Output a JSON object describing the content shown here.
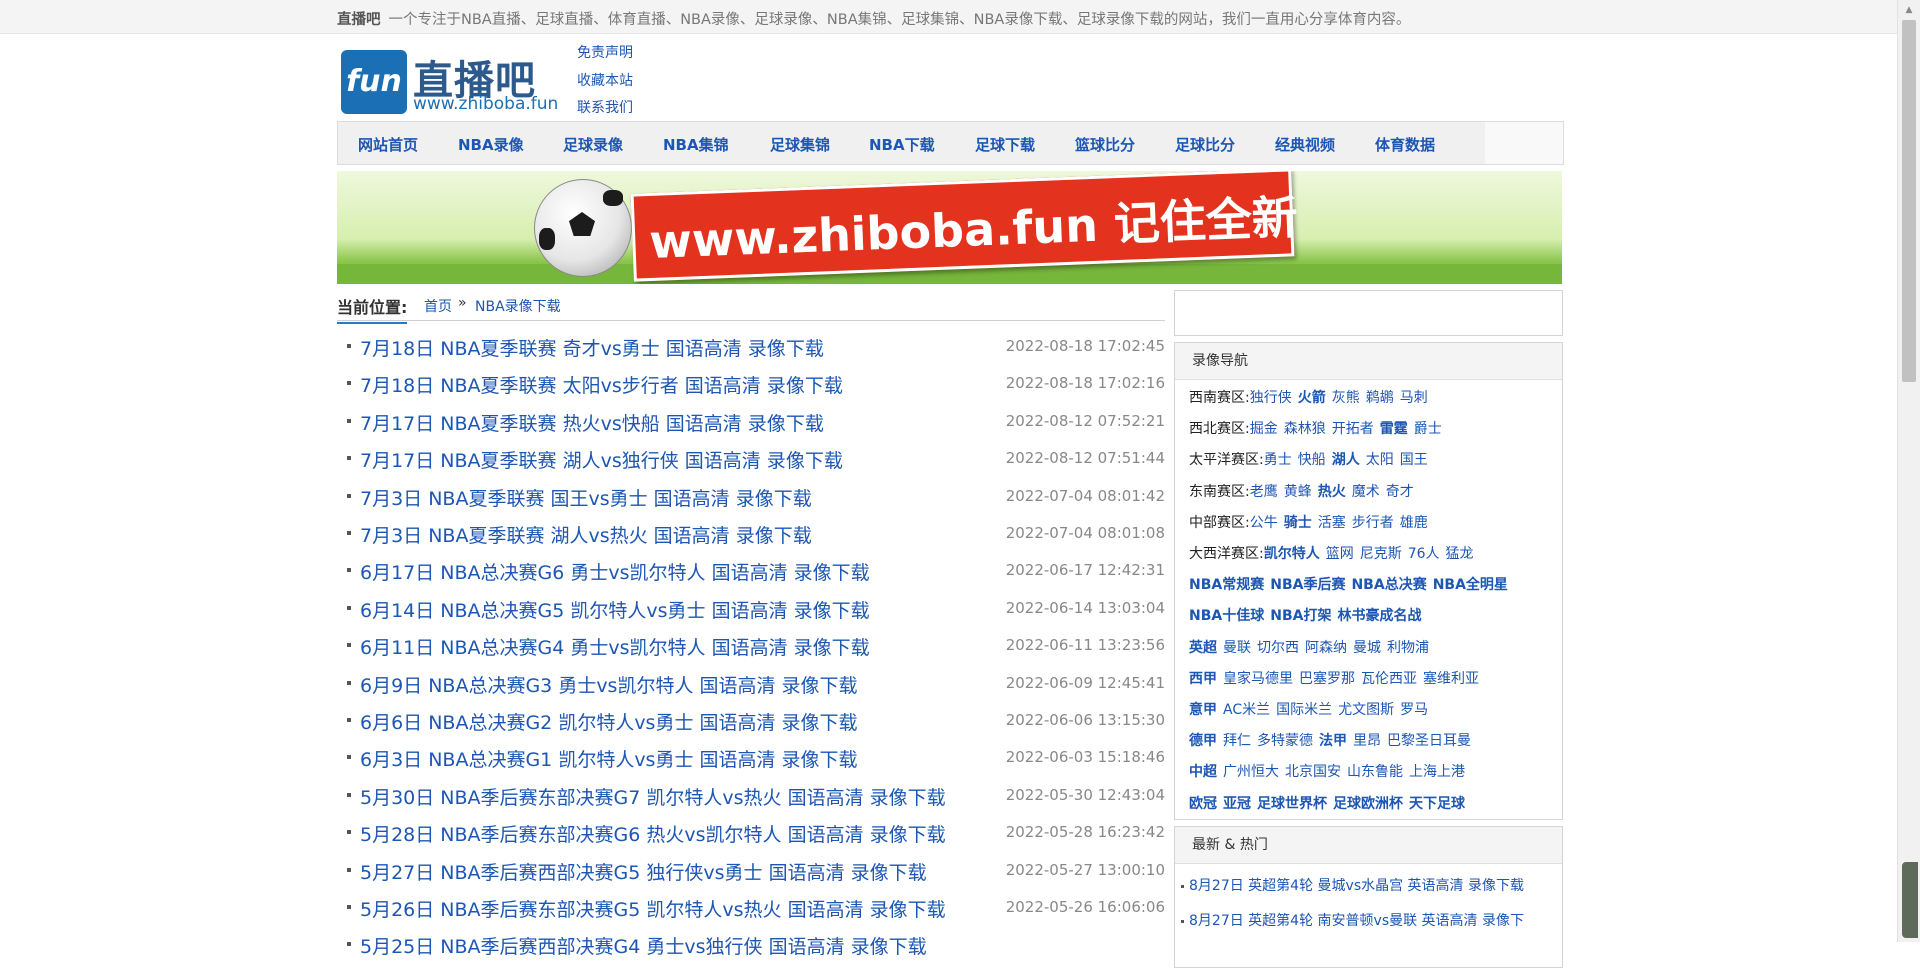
{
  "topbar": {
    "site_name": "直播吧",
    "tagline": "一个专注于NBA直播、足球直播、体育直播、NBA录像、足球录像、NBA集锦、足球集锦、NBA录像下载、足球录像下载的网站，我们一直用心分享体育内容。"
  },
  "logo": {
    "badge": "fun",
    "name": "直播吧",
    "url": "www.zhiboba.fun"
  },
  "toplinks": [
    "免责声明",
    "收藏本站",
    "联系我们"
  ],
  "nav": [
    "网站首页",
    "NBA录像",
    "足球录像",
    "NBA集锦",
    "足球集锦",
    "NBA下载",
    "足球下载",
    "篮球比分",
    "足球比分",
    "经典视频",
    "体育数据"
  ],
  "banner": {
    "text": "www.zhiboba.fun 记住全新"
  },
  "breadcrumb": {
    "label": "当前位置:",
    "home": "首页",
    "separator": "»",
    "current": "NBA录像下载"
  },
  "articles": [
    {
      "title": "7月18日 NBA夏季联赛 奇才vs勇士 国语高清 录像下载",
      "date": "2022-08-18 17:02:45"
    },
    {
      "title": "7月18日 NBA夏季联赛 太阳vs步行者 国语高清 录像下载",
      "date": "2022-08-18 17:02:16"
    },
    {
      "title": "7月17日 NBA夏季联赛 热火vs快船 国语高清 录像下载",
      "date": "2022-08-12 07:52:21"
    },
    {
      "title": "7月17日 NBA夏季联赛 湖人vs独行侠 国语高清 录像下载",
      "date": "2022-08-12 07:51:44"
    },
    {
      "title": "7月3日 NBA夏季联赛 国王vs勇士 国语高清 录像下载",
      "date": "2022-07-04 08:01:42"
    },
    {
      "title": "7月3日 NBA夏季联赛 湖人vs热火 国语高清 录像下载",
      "date": "2022-07-04 08:01:08"
    },
    {
      "title": "6月17日 NBA总决赛G6 勇士vs凯尔特人 国语高清 录像下载",
      "date": "2022-06-17 12:42:31"
    },
    {
      "title": "6月14日 NBA总决赛G5 凯尔特人vs勇士 国语高清 录像下载",
      "date": "2022-06-14 13:03:04"
    },
    {
      "title": "6月11日 NBA总决赛G4 勇士vs凯尔特人 国语高清 录像下载",
      "date": "2022-06-11 13:23:56"
    },
    {
      "title": "6月9日 NBA总决赛G3 勇士vs凯尔特人 国语高清 录像下载",
      "date": "2022-06-09 12:45:41"
    },
    {
      "title": "6月6日 NBA总决赛G2 凯尔特人vs勇士 国语高清 录像下载",
      "date": "2022-06-06 13:15:30"
    },
    {
      "title": "6月3日 NBA总决赛G1 凯尔特人vs勇士 国语高清 录像下载",
      "date": "2022-06-03 15:18:46"
    },
    {
      "title": "5月30日 NBA季后赛东部决赛G7 凯尔特人vs热火 国语高清 录像下载",
      "date": "2022-05-30 12:43:04"
    },
    {
      "title": "5月28日 NBA季后赛东部决赛G6 热火vs凯尔特人 国语高清 录像下载",
      "date": "2022-05-28 16:23:42"
    },
    {
      "title": "5月27日 NBA季后赛西部决赛G5 独行侠vs勇士 国语高清 录像下载",
      "date": "2022-05-27 13:00:10"
    },
    {
      "title": "5月26日 NBA季后赛东部决赛G5 凯尔特人vs热火 国语高清 录像下载",
      "date": "2022-05-26 16:06:06"
    },
    {
      "title": "5月25日 NBA季后赛西部决赛G4 勇士vs独行侠 国语高清 录像下载",
      "date": ""
    }
  ],
  "sidebar": {
    "nav_title": "录像导航",
    "rows": [
      {
        "label": "西南赛区:",
        "links": [
          {
            "t": "独行侠",
            "b": false
          },
          {
            "t": "火箭",
            "b": true
          },
          {
            "t": "灰熊",
            "b": false
          },
          {
            "t": "鹈鹕",
            "b": false
          },
          {
            "t": "马刺",
            "b": false
          }
        ]
      },
      {
        "label": "西北赛区:",
        "links": [
          {
            "t": "掘金",
            "b": false
          },
          {
            "t": "森林狼",
            "b": false
          },
          {
            "t": "开拓者",
            "b": false
          },
          {
            "t": "雷霆",
            "b": true
          },
          {
            "t": "爵士",
            "b": false
          }
        ]
      },
      {
        "label": "太平洋赛区:",
        "links": [
          {
            "t": "勇士",
            "b": false
          },
          {
            "t": "快船",
            "b": false
          },
          {
            "t": "湖人",
            "b": true
          },
          {
            "t": "太阳",
            "b": false
          },
          {
            "t": "国王",
            "b": false
          }
        ]
      },
      {
        "label": "东南赛区:",
        "links": [
          {
            "t": "老鹰",
            "b": false
          },
          {
            "t": "黄蜂",
            "b": false
          },
          {
            "t": "热火",
            "b": true
          },
          {
            "t": "魔术",
            "b": false
          },
          {
            "t": "奇才",
            "b": false
          }
        ]
      },
      {
        "label": "中部赛区:",
        "links": [
          {
            "t": "公牛",
            "b": false
          },
          {
            "t": "骑士",
            "b": true
          },
          {
            "t": "活塞",
            "b": false
          },
          {
            "t": "步行者",
            "b": false
          },
          {
            "t": "雄鹿",
            "b": false
          }
        ]
      },
      {
        "label": "大西洋赛区:",
        "links": [
          {
            "t": "凯尔特人",
            "b": true
          },
          {
            "t": "篮网",
            "b": false
          },
          {
            "t": "尼克斯",
            "b": false
          },
          {
            "t": "76人",
            "b": false
          },
          {
            "t": "猛龙",
            "b": false
          }
        ]
      },
      {
        "label": "",
        "links": [
          {
            "t": "NBA常规赛",
            "b": true
          },
          {
            "t": "NBA季后赛",
            "b": true
          },
          {
            "t": "NBA总决赛",
            "b": true
          },
          {
            "t": "NBA全明星",
            "b": true
          }
        ]
      },
      {
        "label": "",
        "links": [
          {
            "t": "NBA十佳球",
            "b": true
          },
          {
            "t": "NBA打架",
            "b": true
          },
          {
            "t": "林书豪成名战",
            "b": true
          }
        ]
      },
      {
        "label": "",
        "links": [
          {
            "t": "英超",
            "b": true
          },
          {
            "t": "曼联",
            "b": false
          },
          {
            "t": "切尔西",
            "b": false
          },
          {
            "t": "阿森纳",
            "b": false
          },
          {
            "t": "曼城",
            "b": false
          },
          {
            "t": "利物浦",
            "b": false
          }
        ]
      },
      {
        "label": "",
        "links": [
          {
            "t": "西甲",
            "b": true
          },
          {
            "t": "皇家马德里",
            "b": false
          },
          {
            "t": "巴塞罗那",
            "b": false
          },
          {
            "t": "瓦伦西亚",
            "b": false
          },
          {
            "t": "塞维利亚",
            "b": false
          }
        ]
      },
      {
        "label": "",
        "links": [
          {
            "t": "意甲",
            "b": true
          },
          {
            "t": "AC米兰",
            "b": false
          },
          {
            "t": "国际米兰",
            "b": false
          },
          {
            "t": "尤文图斯",
            "b": false
          },
          {
            "t": "罗马",
            "b": false
          }
        ]
      },
      {
        "label": "",
        "links": [
          {
            "t": "德甲",
            "b": true
          },
          {
            "t": "拜仁",
            "b": false
          },
          {
            "t": "多特蒙德",
            "b": false
          },
          {
            "t": "法甲",
            "b": true
          },
          {
            "t": "里昂",
            "b": false
          },
          {
            "t": "巴黎圣日耳曼",
            "b": false
          }
        ]
      },
      {
        "label": "",
        "links": [
          {
            "t": "中超",
            "b": true
          },
          {
            "t": "广州恒大",
            "b": false
          },
          {
            "t": "北京国安",
            "b": false
          },
          {
            "t": "山东鲁能",
            "b": false
          },
          {
            "t": "上海上港",
            "b": false
          }
        ]
      },
      {
        "label": "",
        "links": [
          {
            "t": "欧冠",
            "b": true
          },
          {
            "t": "亚冠",
            "b": true
          },
          {
            "t": "足球世界杯",
            "b": true
          },
          {
            "t": "足球欧洲杯",
            "b": true
          },
          {
            "t": "天下足球",
            "b": true
          }
        ]
      }
    ],
    "hot_title": "最新 & 热门",
    "hot": [
      "8月27日 英超第4轮 曼城vs水晶宫 英语高清 录像下载",
      "8月27日 英超第4轮 南安普顿vs曼联 英语高清 录像下"
    ]
  }
}
